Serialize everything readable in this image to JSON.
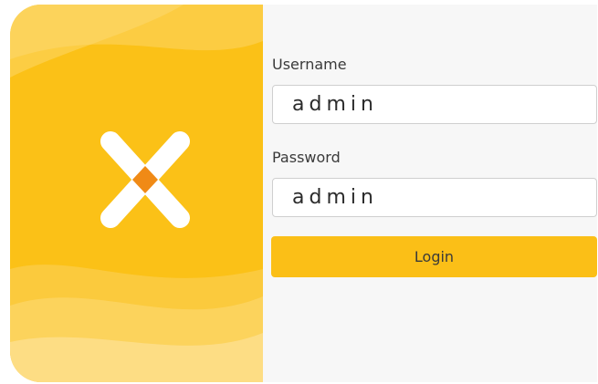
{
  "colors": {
    "brand_primary": "#fbc117",
    "brand_light": "#fdd566",
    "logo_mark": "#ffffff",
    "logo_center": "#f08a16",
    "form_background": "#f7f7f7",
    "button_background": "#fbbf17"
  },
  "logo": {
    "icon": "x-logo-icon"
  },
  "form": {
    "username_label": "Username",
    "username_value": "admin",
    "password_label": "Password",
    "password_value": "admin",
    "login_label": "Login"
  }
}
